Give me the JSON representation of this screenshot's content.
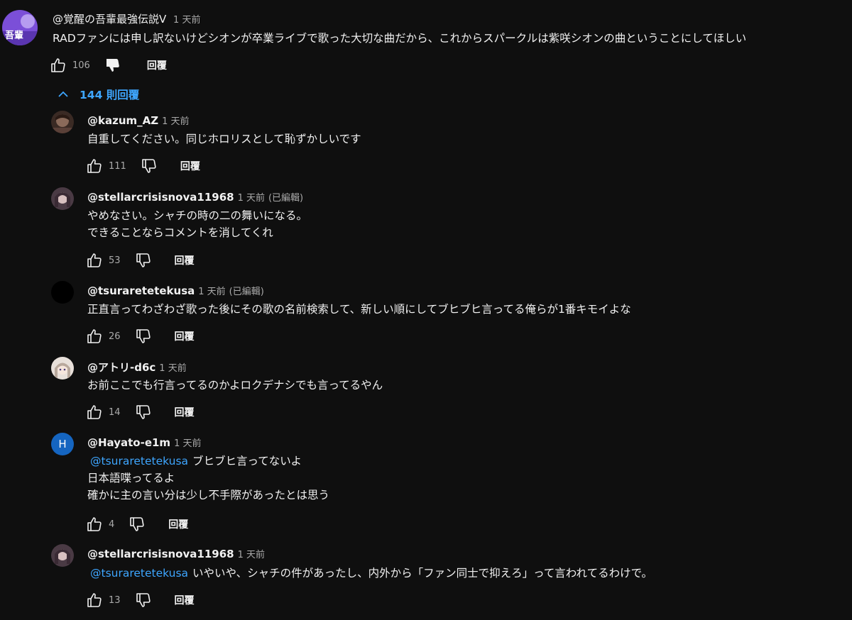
{
  "top_comment": {
    "author": "@覚醒の吾輩最強伝説V",
    "time": "1 天前",
    "text": "RADファンには申し訳ないけどシオンが卒業ライブで歌った大切な曲だから、これからスパークルは紫咲シオンの曲ということにしてほしい",
    "likes": "106",
    "reply_label": "回覆",
    "avatar_text": "吾輩"
  },
  "replies_toggle": {
    "label": "144 則回覆"
  },
  "replies": [
    {
      "author": "@kazum_AZ",
      "time": "1 天前",
      "edited": "",
      "mention": "",
      "lines": [
        "自重してください。同じホロリスとして恥ずかしいです"
      ],
      "likes": "111",
      "reply_label": "回覆",
      "avatar_letter": ""
    },
    {
      "author": "@stellarcrisisnova11968",
      "time": "1 天前",
      "edited": "(已編輯)",
      "mention": "",
      "lines": [
        "やめなさい。シャチの時の二の舞いになる。",
        "できることならコメントを消してくれ"
      ],
      "likes": "53",
      "reply_label": "回覆",
      "avatar_letter": ""
    },
    {
      "author": "@tsuraretetekusa",
      "time": "1 天前",
      "edited": "(已編輯)",
      "mention": "",
      "lines": [
        "正直言ってわざわざ歌った後にその歌の名前検索して、新しい順にしてブヒブヒ言ってる俺らが1番キモイよな"
      ],
      "likes": "26",
      "reply_label": "回覆",
      "avatar_letter": ""
    },
    {
      "author": "@アトリ-d6c",
      "time": "1 天前",
      "edited": "",
      "mention": "",
      "lines": [
        "お前ここでも行言ってるのかよロクデナシでも言ってるやん"
      ],
      "likes": "14",
      "reply_label": "回覆",
      "avatar_letter": ""
    },
    {
      "author": "@Hayato-e1m",
      "time": "1 天前",
      "edited": "",
      "mention": "@tsuraretetekusa",
      "lines": [
        "ブヒブヒ言ってないよ",
        "日本語喋ってるよ",
        "確かに主の言い分は少し不手際があったとは思う"
      ],
      "likes": "4",
      "reply_label": "回覆",
      "avatar_letter": "H"
    },
    {
      "author": "@stellarcrisisnova11968",
      "time": "1 天前",
      "edited": "",
      "mention": "@tsuraretetekusa",
      "lines": [
        "いやいや、シャチの件があったし、内外から「ファン同士で抑えろ」って言われてるわけで。"
      ],
      "likes": "13",
      "reply_label": "回覆",
      "avatar_letter": ""
    }
  ],
  "colors": {
    "background": "#0f0f0f",
    "text": "#f1f1f1",
    "secondary_text": "#aaaaaa",
    "link": "#3ea6ff",
    "avatar_purple": "#7b4fd8",
    "avatar_blue": "#1565c0"
  },
  "icons": {
    "like": "thumbs-up-outline-icon",
    "dislike": "thumbs-down-outline-icon",
    "dislike_active": "thumbs-down-filled-icon",
    "expand": "chevron-up-icon"
  }
}
